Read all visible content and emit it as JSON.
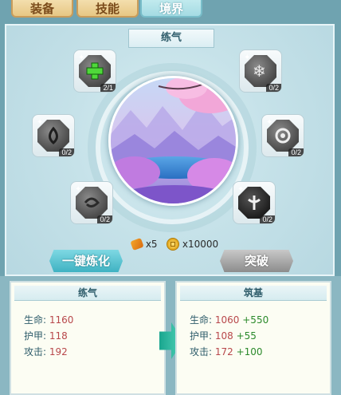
{
  "tabs": [
    {
      "label": "装备"
    },
    {
      "label": "技能"
    },
    {
      "label": "境界"
    }
  ],
  "realm": {
    "title": "练气",
    "slots": [
      {
        "icon": "green-plus-gem-icon",
        "count": "2/1"
      },
      {
        "icon": "snowflake-gem-icon",
        "count": "0/2"
      },
      {
        "icon": "flame-gem-icon",
        "count": "0/2"
      },
      {
        "icon": "spiral-gem-icon",
        "count": "0/2"
      },
      {
        "icon": "swirl-gem-icon",
        "count": "0/2"
      },
      {
        "icon": "trident-gem-icon",
        "count": "0/2"
      }
    ]
  },
  "cost": {
    "scroll_amount": "x5",
    "coin_amount": "x10000"
  },
  "buttons": {
    "refine": "一键炼化",
    "breakthrough": "突破"
  },
  "current": {
    "title": "练气",
    "stats": [
      {
        "label": "生命:",
        "value": "1160"
      },
      {
        "label": "护甲:",
        "value": "118"
      },
      {
        "label": "攻击:",
        "value": "192"
      }
    ]
  },
  "next": {
    "title": "筑基",
    "stats": [
      {
        "label": "生命:",
        "value": "1060",
        "bonus": "+550"
      },
      {
        "label": "护甲:",
        "value": "108",
        "bonus": "+55"
      },
      {
        "label": "攻击:",
        "value": "172",
        "bonus": "+100"
      }
    ]
  }
}
